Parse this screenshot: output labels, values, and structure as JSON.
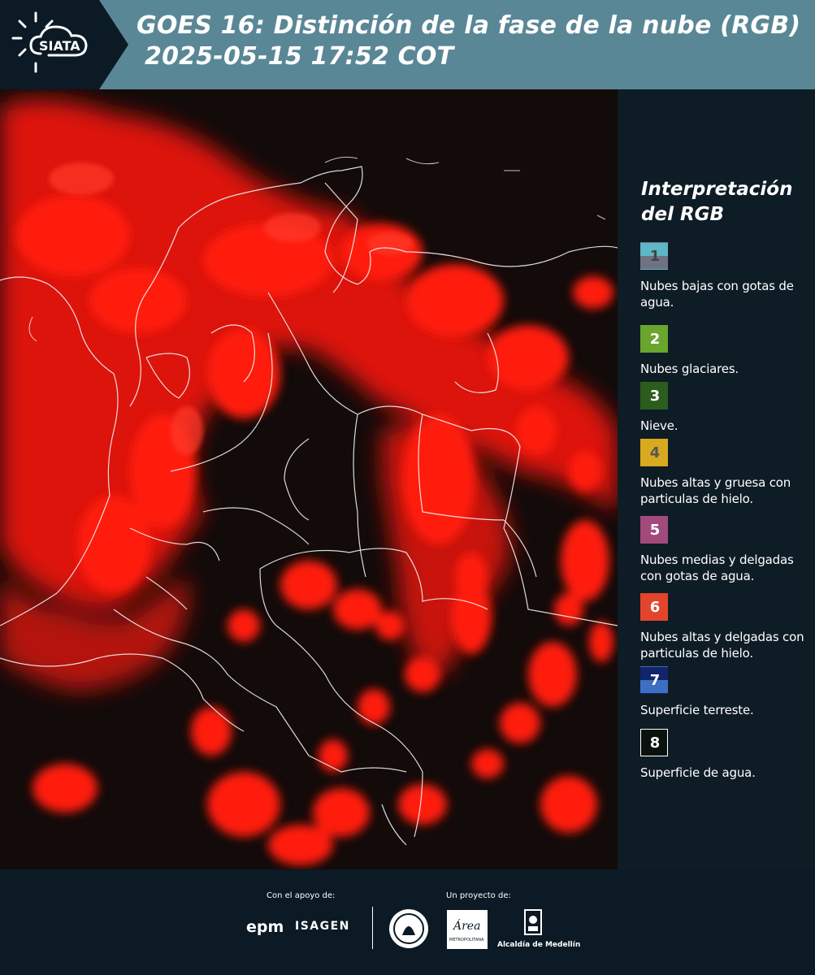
{
  "header": {
    "logo_text": "SIATA",
    "title_line1": "GOES 16: Distinción de la fase de la nube (RGB)",
    "title_line2": "2025-05-15 17:52 COT"
  },
  "legend": {
    "title": "Interpretación del RGB",
    "items": [
      {
        "num": "1",
        "text": "Nubes bajas con gotas de agua.",
        "color_top": "#5fb6c6",
        "color_bottom": "#6f7285",
        "num_color": "#444444"
      },
      {
        "num": "2",
        "text": "Nubes glaciares.",
        "color_top": "#6aa52e",
        "color_bottom": "#6aa52e",
        "num_color": "#ffffff"
      },
      {
        "num": "3",
        "text": "Nieve.",
        "color_top": "#2c5d1c",
        "color_bottom": "#2c5d1c",
        "num_color": "#ffffff"
      },
      {
        "num": "4",
        "text": "Nubes altas y gruesa con particulas de hielo.",
        "color_top": "#d9a91f",
        "color_bottom": "#d9a91f",
        "num_color": "#555555"
      },
      {
        "num": "5",
        "text": "Nubes medias y delgadas con gotas de agua.",
        "color_top": "#a24a7c",
        "color_bottom": "#a24a7c",
        "num_color": "#ffffff"
      },
      {
        "num": "6",
        "text": "Nubes altas y delgadas con particulas de hielo.",
        "color_top": "#e2452b",
        "color_bottom": "#e2452b",
        "num_color": "#ffffff"
      },
      {
        "num": "7",
        "text": "Superficie terreste.",
        "color_top": "#12246b",
        "color_bottom": "#3d6fc2",
        "num_color": "#ffffff"
      },
      {
        "num": "8",
        "text": "Superficie de agua.",
        "color_top": "#0b120d",
        "color_bottom": "#0b120d",
        "num_color": "#ffffff"
      }
    ]
  },
  "footer": {
    "support_label": "Con el apoyo de:",
    "project_label": "Un proyecto de:",
    "epm": "epm",
    "isagen": "ISAGEN",
    "area_text": "Área",
    "area_sub": "METROPOLITANA",
    "alcaldia": "Alcaldía de Medellín"
  },
  "colors": {
    "header_bg": "#5a8796",
    "side_bg": "#0e1c26",
    "cloud_red": "#ff1a10"
  }
}
